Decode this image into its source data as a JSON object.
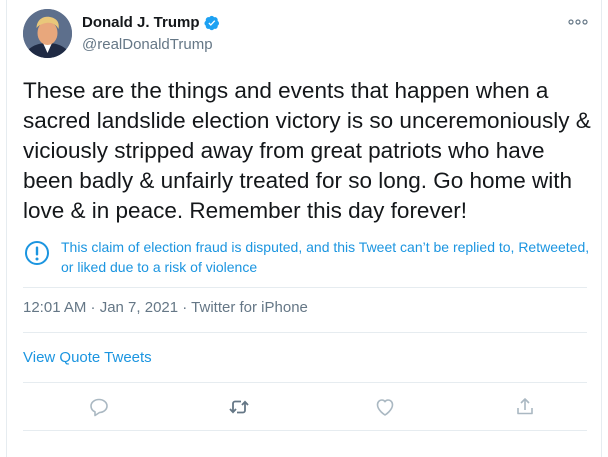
{
  "author": {
    "name": "Donald J. Trump",
    "handle": "@realDonaldTrump",
    "verified": true,
    "avatar_icon": "profile-photo"
  },
  "tweet": {
    "text": "These are the things and events that happen when a sacred landslide election victory is so unceremoniously & viciously stripped away from great patriots who have been badly & unfairly treated for so long. Go home with love & in peace. Remember this day forever!"
  },
  "notice": {
    "icon": "exclamation-circle-icon",
    "text": "This claim of election fraud is disputed, and this Tweet can’t be replied to, Retweeted, or liked due to a risk of violence"
  },
  "meta": {
    "timestamp": "12:01 AM · Jan 7, 2021 · Twitter for iPhone"
  },
  "links": {
    "view_quote_tweets": "View Quote Tweets"
  },
  "actions": [
    "reply-icon",
    "retweet-icon",
    "like-icon",
    "share-icon"
  ],
  "colors": {
    "accent": "#1b95e0",
    "secondary_text": "#657786",
    "divider": "#e6ecf0",
    "verified_badge": "#1da1f2"
  }
}
